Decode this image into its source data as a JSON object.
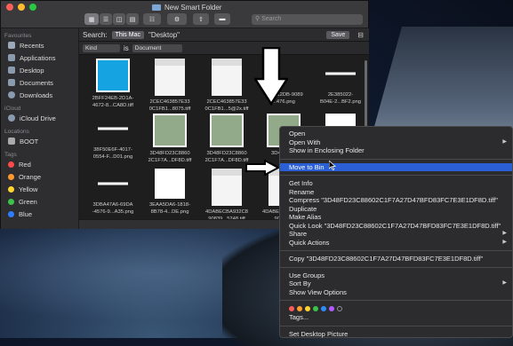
{
  "window": {
    "title": "New Smart Folder",
    "search_placeholder": "Search",
    "scope_label": "Search:",
    "scope_this_mac": "This Mac",
    "scope_desktop": "\"Desktop\"",
    "save_label": "Save",
    "criteria_kind": "Kind",
    "criteria_is": "is",
    "criteria_value": "Document"
  },
  "sidebar": {
    "favourites_label": "Favourites",
    "favourites": [
      "Recents",
      "Applications",
      "Desktop",
      "Documents",
      "Downloads"
    ],
    "icloud_label": "iCloud",
    "icloud": [
      "iCloud Drive"
    ],
    "locations_label": "Locations",
    "locations": [
      "BOOT"
    ],
    "tags_label": "Tags",
    "tags": [
      {
        "name": "Red",
        "color": "#ff4a4a"
      },
      {
        "name": "Orange",
        "color": "#ff9a2e"
      },
      {
        "name": "Yellow",
        "color": "#ffd52e"
      },
      {
        "name": "Green",
        "color": "#3cc24a"
      },
      {
        "name": "Blue",
        "color": "#2e7cff"
      }
    ]
  },
  "files": [
    {
      "line1": "2BFF24EB-2D1A-",
      "line2": "4672-8...CA8D.tiff",
      "thumb": "blue"
    },
    {
      "line1": "2CEC463857E33",
      "line2": "0C1FB1...8075.tiff",
      "thumb": "doc"
    },
    {
      "line1": "2CEC463857E33",
      "line2": "0C1FB1...5@2x.tiff",
      "thumb": "doc"
    },
    {
      "line1": "2D1F12DB-9089",
      "line2": "...476.png",
      "thumb": "none"
    },
    {
      "line1": "2E385022-",
      "line2": "B04E-2...BF2.png",
      "thumb": "line"
    },
    {
      "line1": "38F50E6F-4017-",
      "line2": "0554-F...D01.png",
      "thumb": "line"
    },
    {
      "line1": "3D48FD23C8860",
      "line2": "2C1F7A...DF8D.tiff",
      "thumb": "green"
    },
    {
      "line1": "3D48FD23C8860",
      "line2": "2C1F7A...DF8D.tiff",
      "thumb": "green"
    },
    {
      "line1": "3D48FD23",
      "line2": "",
      "thumb": "green"
    },
    {
      "line1": "",
      "line2": "",
      "thumb": "white"
    },
    {
      "line1": "3DBA47A6-69DA",
      "line2": "-4576-9...A35.png",
      "thumb": "line"
    },
    {
      "line1": "3EAA5DA6-1818-",
      "line2": "8B78-4...DE.png",
      "thumb": "white"
    },
    {
      "line1": "4DABECBA932C8",
      "line2": "90839...5248.tiff",
      "thumb": "doc"
    },
    {
      "line1": "4DABECBA932C8",
      "line2": "90839...",
      "thumb": "doc"
    },
    {
      "line1": "",
      "line2": "",
      "thumb": "none"
    }
  ],
  "menu": {
    "group1": [
      "Open",
      "Open With",
      "Show in Enclosing Folder"
    ],
    "move_to_bin": "Move to Bin",
    "group2": [
      "Get Info",
      "Rename",
      "Compress \"3D48FD23C88602C1F7A27D47BFD83FC7E3E1DF8D.tiff\"",
      "Duplicate",
      "Make Alias",
      "Quick Look \"3D48FD23C88602C1F7A27D47BFD83FC7E3E1DF8D.tiff\"",
      "Share",
      "Quick Actions"
    ],
    "copy": "Copy \"3D48FD23C88602C1F7A27D47BFD83FC7E3E1DF8D.tiff\"",
    "group3": [
      "Use Groups",
      "Sort By",
      "Show View Options"
    ],
    "tag_colors": [
      "#ff5a5a",
      "#ff9f2e",
      "#ffd52e",
      "#3cc24a",
      "#2e8cff",
      "#b05cff",
      "#8e8e93"
    ],
    "tags_item": "Tags...",
    "desktop_picture": "Set Desktop Picture"
  }
}
